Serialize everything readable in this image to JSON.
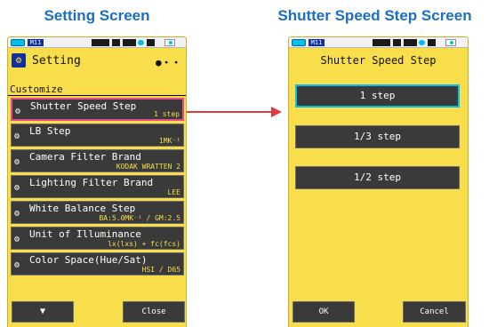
{
  "captions": {
    "left": "Setting Screen",
    "right": "Shutter Speed Step Screen"
  },
  "status_bar": {
    "memory_label": "M11",
    "battery_color": "#00bfef"
  },
  "setting_screen": {
    "title": "Setting",
    "title_icon": "settings-app-icon",
    "page_indicator": "●・・",
    "section": "Customize",
    "items": [
      {
        "label": "Shutter Speed Step",
        "value": "1 step",
        "selected": true
      },
      {
        "label": "LB Step",
        "value": "1MK⁻¹",
        "selected": false
      },
      {
        "label": "Camera Filter Brand",
        "value": "KODAK WRATTEN 2",
        "selected": false
      },
      {
        "label": "Lighting Filter Brand",
        "value": "LEE",
        "selected": false
      },
      {
        "label": "White Balance Step",
        "value": "BA:5.0MK⁻¹ / GM:2.5",
        "selected": false
      },
      {
        "label": "Unit of Illuminance",
        "value": "lx(lxs) + fc(fcs)",
        "selected": false
      },
      {
        "label": "Color Space(Hue/Sat)",
        "value": "HSI / D65",
        "selected": false
      }
    ],
    "scroll_button": "▼",
    "close_button": "Close"
  },
  "shutter_screen": {
    "title": "Shutter Speed Step",
    "options": [
      {
        "label": "1 step",
        "active": true
      },
      {
        "label": "1/3 step",
        "active": false
      },
      {
        "label": "1/2 step",
        "active": false
      }
    ],
    "ok_button": "OK",
    "cancel_button": "Cancel"
  },
  "colors": {
    "screen_bg": "#f9de4b",
    "button_bg": "#3a3a3a",
    "caption": "#1a6fc4",
    "selected_border": "#e84c8f",
    "active_border": "#00bfef",
    "arrow": "#e23a3a"
  },
  "icons": {
    "menu_item_icon": "gears-icon",
    "arrow": "right-arrow-icon"
  }
}
